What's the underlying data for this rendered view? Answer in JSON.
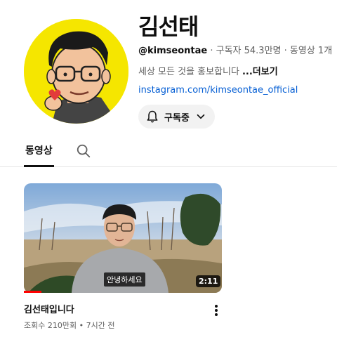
{
  "channel": {
    "name": "김선태",
    "handle": "@kimseontae",
    "subscribers": "구독자 54.3만명",
    "video_count": "동영상 1개",
    "separator": " · ",
    "description": "세상 모든 것을 홍보합니다",
    "more_label": "...더보기",
    "link": "instagram.com/kimseontae_official",
    "avatar_icon": "cartoon-avatar"
  },
  "subscribe": {
    "label": "구독중",
    "bell_icon": "bell-icon",
    "chevron_icon": "chevron-down-icon"
  },
  "tabs": {
    "videos_label": "동영상",
    "search_icon": "search-icon"
  },
  "video": {
    "title": "김선태입니다",
    "views": "조회수 210만회",
    "age": "7시간 전",
    "meta_separator": " • ",
    "duration": "2:11",
    "caption": "안녕하세요",
    "watched_fraction": 0.09
  },
  "colors": {
    "avatar_bg": "#f5e600",
    "link": "#065fd4",
    "progress": "#ff0000"
  }
}
